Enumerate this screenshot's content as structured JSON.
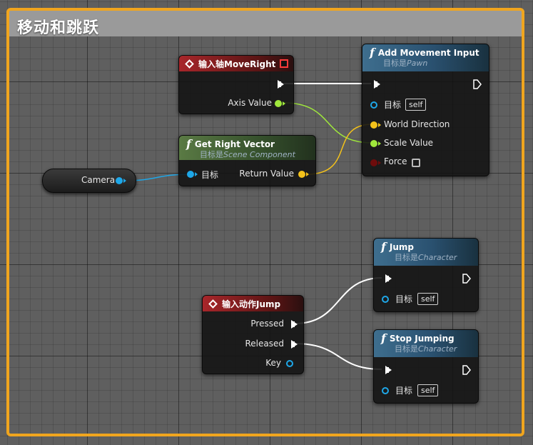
{
  "comment": {
    "title": "移动和跳跃"
  },
  "nodes": {
    "move_right": {
      "title": "输入轴MoveRight",
      "axis_value": "Axis Value"
    },
    "get_right_vector": {
      "title": "Get Right Vector",
      "subtitle_prefix": "目标是",
      "subtitle_target": "Scene Component",
      "target_label": "目标",
      "return_label": "Return Value"
    },
    "camera": {
      "label": "Camera"
    },
    "add_movement_input": {
      "title": "Add Movement Input",
      "subtitle_prefix": "目标是",
      "subtitle_target": "Pawn",
      "target_label": "目标",
      "target_value": "self",
      "world_direction": "World Direction",
      "scale_value": "Scale Value",
      "force": "Force"
    },
    "jump_action": {
      "title": "输入动作Jump",
      "pressed": "Pressed",
      "released": "Released",
      "key": "Key"
    },
    "jump": {
      "title": "Jump",
      "subtitle_prefix": "目标是",
      "subtitle_target": "Character",
      "target_label": "目标",
      "target_value": "self"
    },
    "stop_jumping": {
      "title": "Stop Jumping",
      "subtitle_prefix": "目标是",
      "subtitle_target": "Character",
      "target_label": "目标",
      "target_value": "self"
    }
  },
  "colors": {
    "comment_border": "#f0a51e",
    "object_pin": "#1ea7e8",
    "vector_pin": "#f4c21b",
    "float_pin": "#a0e83c",
    "bool_pin": "#8a1010",
    "exec_pin": "#ffffff"
  }
}
